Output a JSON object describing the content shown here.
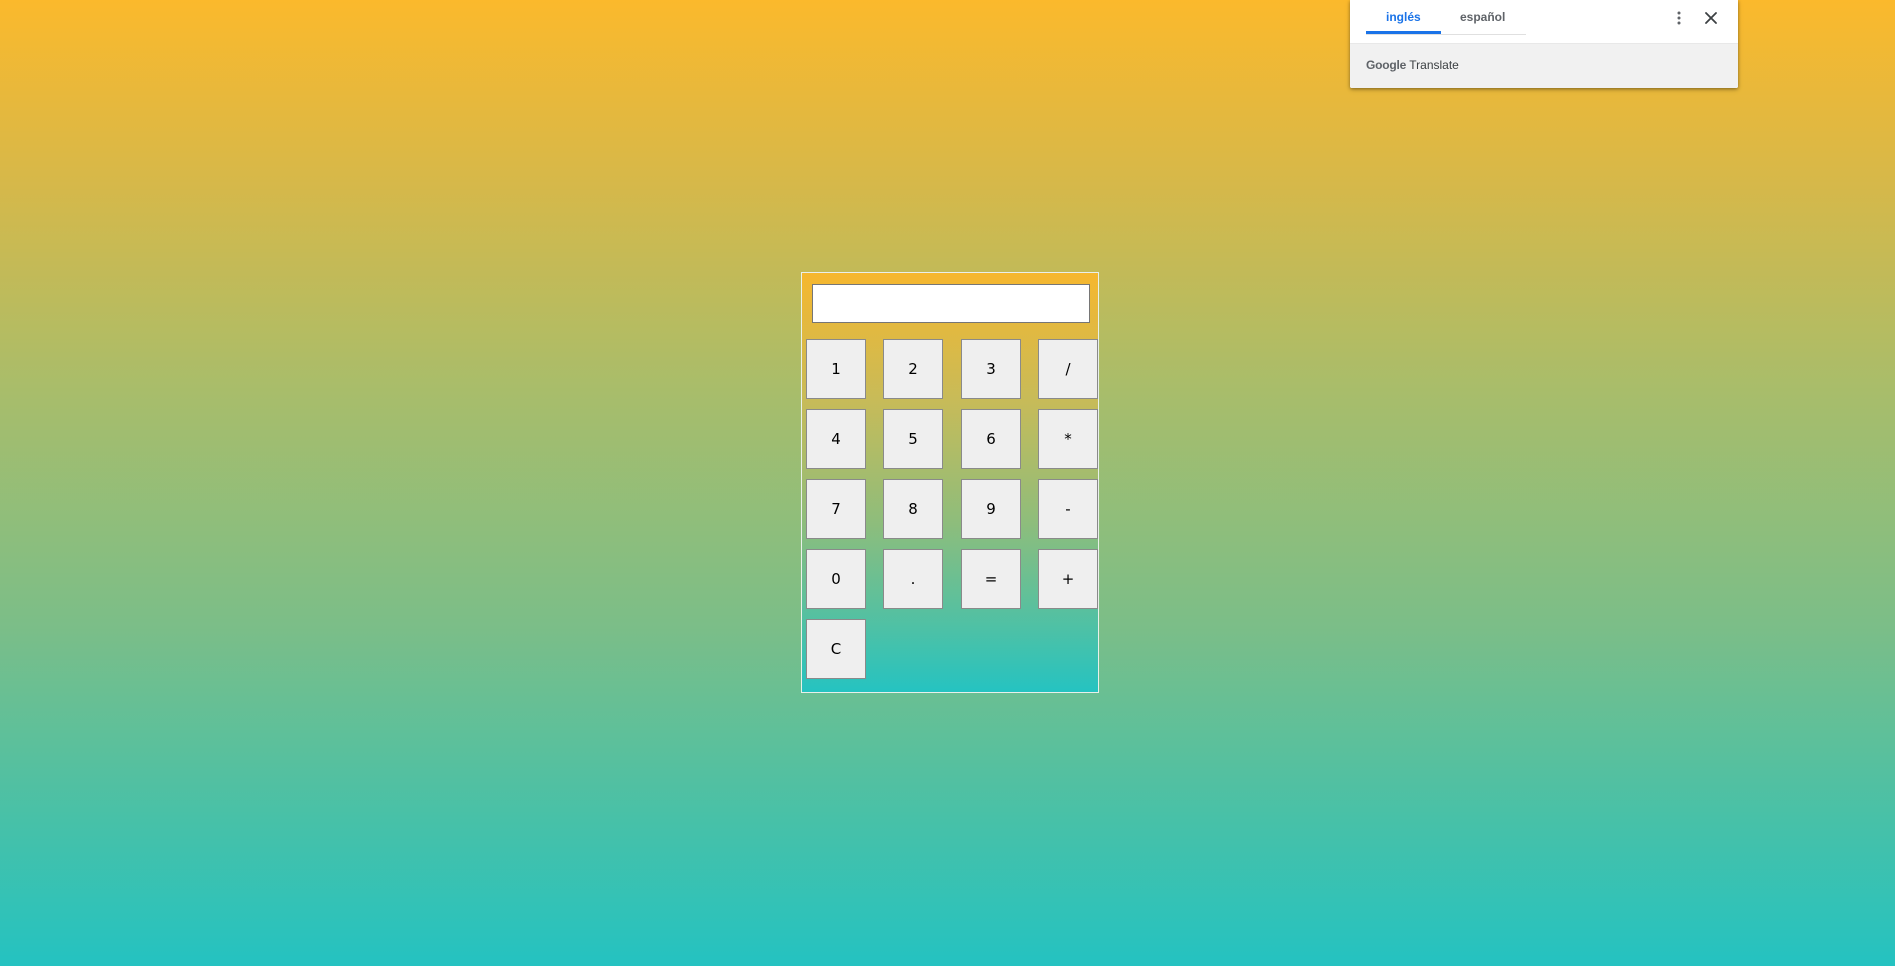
{
  "calculator": {
    "display_value": "",
    "keys": {
      "k1": "1",
      "k2": "2",
      "k3": "3",
      "div": "/",
      "k4": "4",
      "k5": "5",
      "k6": "6",
      "mul": "*",
      "k7": "7",
      "k8": "8",
      "k9": "9",
      "sub": "-",
      "k0": "0",
      "dot": ".",
      "eq": "=",
      "add": "+",
      "clear": "C"
    }
  },
  "translate_popup": {
    "tabs": [
      {
        "label": "inglés",
        "active": true
      },
      {
        "label": "español",
        "active": false
      }
    ],
    "brand_google": "Google",
    "brand_translate": "Translate",
    "accent_color": "#1a73e8",
    "icons": {
      "menu": "more-vert-icon",
      "close": "close-icon"
    }
  },
  "colors": {
    "background_top": "#fbb92c",
    "background_bottom": "#24c2c1"
  }
}
